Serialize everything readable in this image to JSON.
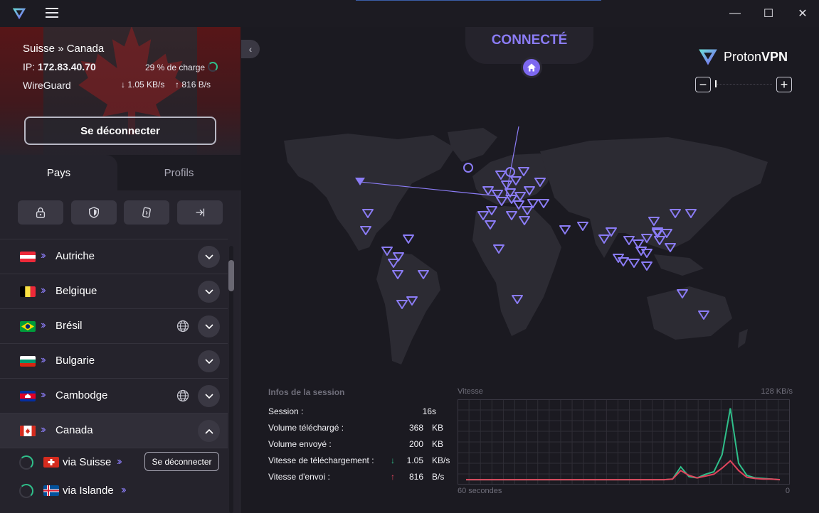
{
  "window": {
    "minimize_label": "—",
    "maximize_label": "☐",
    "close_label": "✕"
  },
  "connection": {
    "route": "Suisse » Canada",
    "ip_label": "IP:",
    "ip": "172.83.40.70",
    "load": "29 % de charge",
    "load_percent": 29,
    "protocol": "WireGuard",
    "download": "1.05 KB/s",
    "upload": "816 B/s",
    "disconnect_label": "Se déconnecter"
  },
  "tabs": {
    "countries": "Pays",
    "profiles": "Profils"
  },
  "countries": [
    {
      "name": "Autriche",
      "flag": "austria",
      "globe": false
    },
    {
      "name": "Belgique",
      "flag": "belgium",
      "globe": false
    },
    {
      "name": "Brésil",
      "flag": "brazil",
      "globe": true
    },
    {
      "name": "Bulgarie",
      "flag": "bulgaria",
      "globe": false
    },
    {
      "name": "Cambodge",
      "flag": "cambodia",
      "globe": true
    },
    {
      "name": "Canada",
      "flag": "canada",
      "globe": false,
      "expanded": true
    }
  ],
  "canada_servers": [
    {
      "label": "via Suisse",
      "flag": "switzerland",
      "action": "Se déconnecter"
    },
    {
      "label": "via Islande",
      "flag": "iceland"
    }
  ],
  "map": {
    "status": "CONNECTÉ",
    "brand_prefix": "Proton",
    "brand_suffix": "VPN",
    "accent": "#8b7cf6"
  },
  "session": {
    "header": "Infos de la session",
    "rows": [
      {
        "label": "Session :",
        "value": "16s",
        "unit": ""
      },
      {
        "label": "Volume téléchargé :",
        "value": "368",
        "unit": "KB"
      },
      {
        "label": "Volume envoyé :",
        "value": "200",
        "unit": "KB"
      },
      {
        "label": "Vitesse de téléchargement :",
        "value": "1.05",
        "unit": "KB/s",
        "arrow": "↓",
        "arrow_color": "#2fbf8a"
      },
      {
        "label": "Vitesse d'envoi :",
        "value": "816",
        "unit": "B/s",
        "arrow": "↑",
        "arrow_color": "#e0445c"
      }
    ]
  },
  "chart_data": {
    "type": "line",
    "title": "Vitesse",
    "ymax_label": "128 KB/s",
    "ylim": [
      0,
      128
    ],
    "x_left_label": "60 secondes",
    "x_right_label": "0",
    "grid": true,
    "x": [
      60,
      58,
      56,
      54,
      52,
      50,
      48,
      46,
      44,
      42,
      40,
      38,
      36,
      34,
      32,
      30,
      28,
      26,
      24,
      22,
      20,
      18,
      16,
      14,
      12,
      10,
      8,
      7,
      6,
      5,
      4,
      3,
      2,
      1,
      0
    ],
    "series": [
      {
        "color": "#2fbf8a",
        "values": [
          1,
          1,
          1,
          1,
          1,
          1,
          1,
          1,
          1,
          1,
          1,
          1,
          1,
          1,
          1,
          1,
          1,
          1,
          1,
          1,
          1,
          1,
          1,
          1,
          1,
          2,
          22,
          6,
          4,
          10,
          14,
          42,
          118,
          28,
          8,
          4,
          3,
          2,
          1
        ]
      },
      {
        "color": "#e0445c",
        "values": [
          1,
          1,
          1,
          1,
          1,
          1,
          1,
          1,
          1,
          1,
          1,
          1,
          1,
          1,
          1,
          1,
          1,
          1,
          1,
          1,
          1,
          1,
          1,
          1,
          1,
          2,
          16,
          8,
          4,
          7,
          10,
          20,
          32,
          16,
          5,
          3,
          2,
          2,
          1
        ]
      }
    ]
  }
}
